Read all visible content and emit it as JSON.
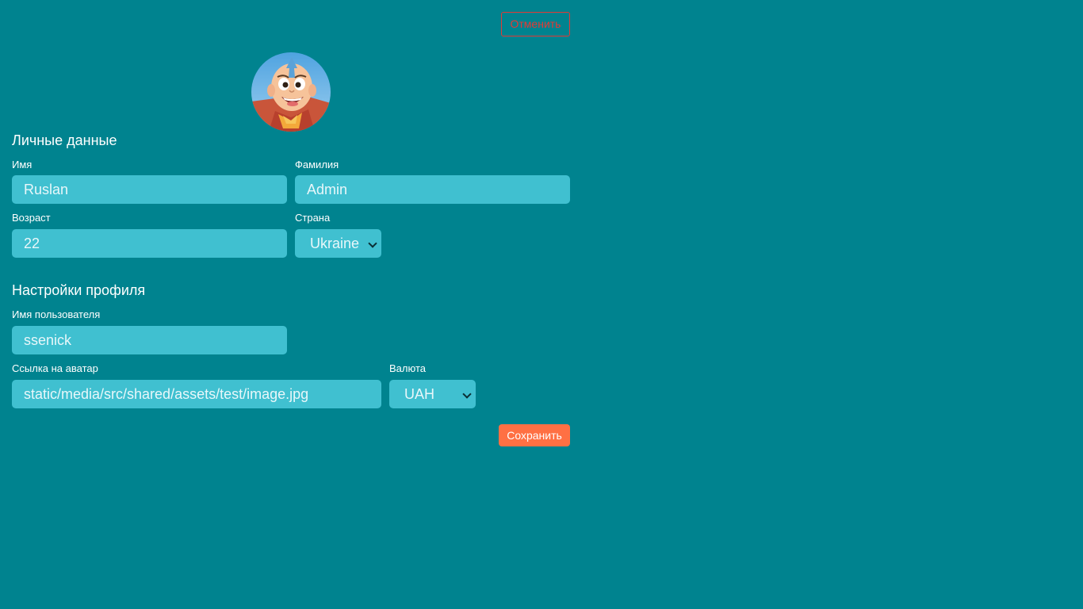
{
  "header": {
    "cancel_label": "Отменить"
  },
  "personal": {
    "title": "Личные данные",
    "first_name": {
      "label": "Имя",
      "value": "Ruslan"
    },
    "last_name": {
      "label": "Фамилия",
      "value": "Admin"
    },
    "age": {
      "label": "Возраст",
      "value": "22"
    },
    "country": {
      "label": "Страна",
      "value": "Ukraine"
    }
  },
  "profile": {
    "title": "Настройки профиля",
    "username": {
      "label": "Имя пользователя",
      "value": "ssenick"
    },
    "avatar_link": {
      "label": "Ссылка на аватар",
      "value": "static/media/src/shared/assets/test/image.jpg"
    },
    "currency": {
      "label": "Валюта",
      "value": "UAH"
    }
  },
  "footer": {
    "save_label": "Сохранить"
  },
  "colors": {
    "background": "#00838f",
    "input_background": "#40c0d0",
    "cancel": "#e53935",
    "save": "#ff7043"
  },
  "icons": {
    "avatar": "cartoon-boy-avatar",
    "select_chevron": "chevron-down-icon"
  }
}
